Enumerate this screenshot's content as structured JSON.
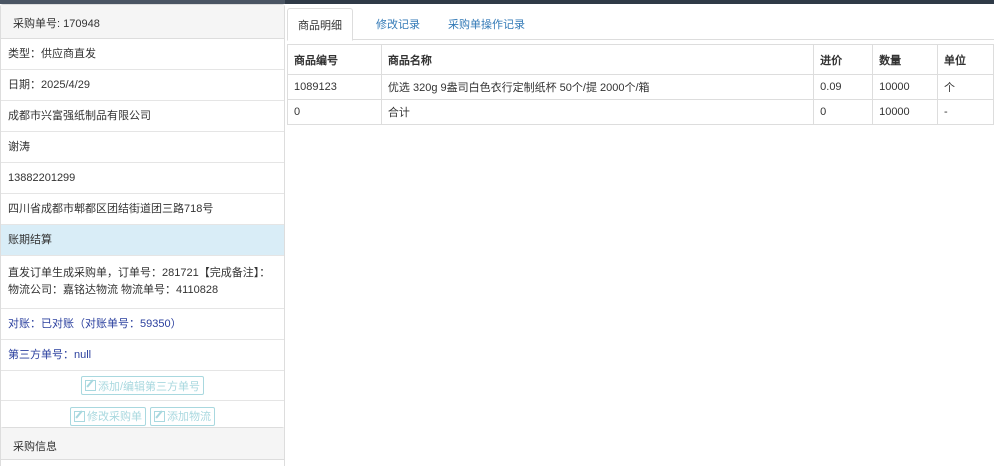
{
  "order": {
    "number_label": "采购单号: 170948",
    "type": "类型：供应商直发",
    "date": "日期：2025/4/29",
    "company": "成都市兴富强纸制品有限公司",
    "contact": "谢涛",
    "phone": "13882201299",
    "address": "四川省成都市郫都区团结街道团三路718号",
    "payment": "账期结算",
    "note": "直发订单生成采购单，订单号：281721【完成备注】：物流公司：嘉铭达物流 物流单号：4110828",
    "reconcile": "对账：已对账（对账单号：59350）",
    "third_party": "第三方单号：null",
    "btn_third_party": "添加/编辑第三方单号",
    "btn_edit": "修改采购单",
    "btn_logistics": "添加物流"
  },
  "purchase_info": {
    "title": "采购信息"
  },
  "tabs": [
    {
      "label": "商品明细"
    },
    {
      "label": "修改记录"
    },
    {
      "label": "采购单操作记录"
    }
  ],
  "table": {
    "headers": [
      "商品编号",
      "商品名称",
      "进价",
      "数量",
      "单位"
    ],
    "rows": [
      [
        "1089123",
        "优选 320g 9盎司白色衣行定制纸杯 50个/提 2000个/箱",
        "0.09",
        "10000",
        "个"
      ],
      [
        "0",
        "合计",
        "0",
        "10000",
        "-"
      ]
    ]
  }
}
